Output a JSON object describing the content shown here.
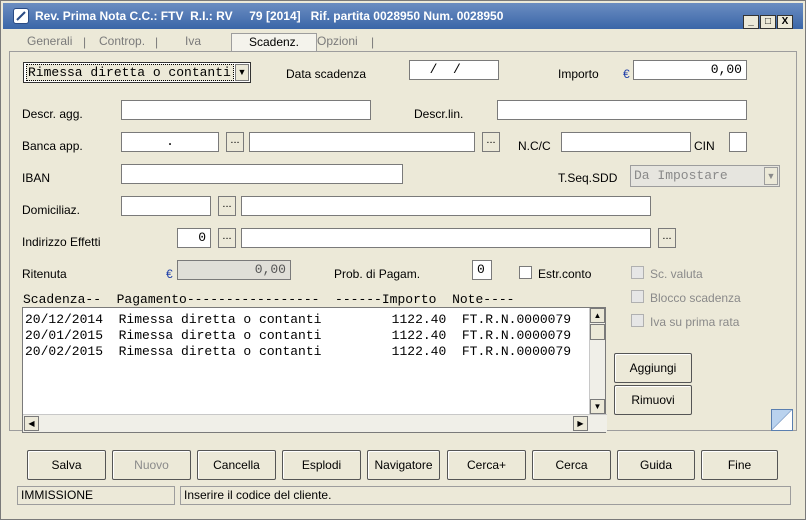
{
  "window": {
    "title": "Rev. Prima Nota C.C.: FTV  R.I.: RV     79 [2014]   Rif. partita 0028950 Num. 0028950",
    "min_label": "_",
    "max_label": "□",
    "close_label": "X"
  },
  "tabs": [
    {
      "label": "Generali"
    },
    {
      "label": "Controp."
    },
    {
      "label": "Iva"
    },
    {
      "label": "Scadenz."
    },
    {
      "label": "Opzioni"
    }
  ],
  "form": {
    "payment_type": "Rimessa diretta o contanti",
    "due_date_label": "Data scadenza",
    "due_date_value": "  /  /",
    "amount_label": "Importo",
    "currency_symbol": "€",
    "amount_value": "0,00",
    "descr_agg_label": "Descr. agg.",
    "descr_agg_value": "",
    "descr_lin_label": "Descr.lin.",
    "descr_lin_value": "",
    "banca_label": "Banca app.",
    "banca_code_value": ".",
    "banca_name_value": "",
    "ncc_label": "N.C/C",
    "ncc_value": "",
    "cin_label": "CIN",
    "cin_value": "",
    "iban_label": "IBAN",
    "iban_value": "",
    "tseq_label": "T.Seq.SDD",
    "tseq_value": "Da Impostare",
    "domic_label": "Domiciliaz.",
    "domic_code_value": "",
    "domic_desc_value": "",
    "indirizzo_label": "Indirizzo Effetti",
    "indirizzo_code_value": "0",
    "indirizzo_desc_value": "",
    "ritenuta_label": "Ritenuta",
    "ritenuta_value": "0,00",
    "prob_label": "Prob. di Pagam.",
    "prob_value": "0",
    "estr_label": "Estr.conto",
    "sc_valuta_label": "Sc. valuta",
    "blocco_label": "Blocco scadenza",
    "iva_prima_label": "Iva su prima rata",
    "dots_label": "..."
  },
  "grid": {
    "header": "Scadenza--  Pagamento-----------------  ------Importo  Note----",
    "rows": [
      "20/12/2014  Rimessa diretta o contanti         1122.40  FT.R.N.0000079",
      "20/01/2015  Rimessa diretta o contanti         1122.40  FT.R.N.0000079",
      "20/02/2015  Rimessa diretta o contanti         1122.40  FT.R.N.0000079"
    ]
  },
  "side_buttons": {
    "aggiungi": "Aggiungi",
    "rimuovi": "Rimuovi"
  },
  "bottom_buttons": [
    {
      "label": "Salva",
      "enabled": true
    },
    {
      "label": "Nuovo",
      "enabled": false
    },
    {
      "label": "Cancella",
      "enabled": true
    },
    {
      "label": "Esplodi",
      "enabled": true
    },
    {
      "label": "Navigatore",
      "enabled": true
    },
    {
      "label": "Cerca+",
      "enabled": true
    },
    {
      "label": "Cerca",
      "enabled": true
    },
    {
      "label": "Guida",
      "enabled": true
    },
    {
      "label": "Fine",
      "enabled": true
    }
  ],
  "status": {
    "mode": "IMMISSIONE",
    "message": "Inserire il codice del cliente."
  },
  "colors": {
    "title_bar": "#3a66a8",
    "window_bg": "#ece9d8",
    "euro": "#1f3fa8"
  }
}
